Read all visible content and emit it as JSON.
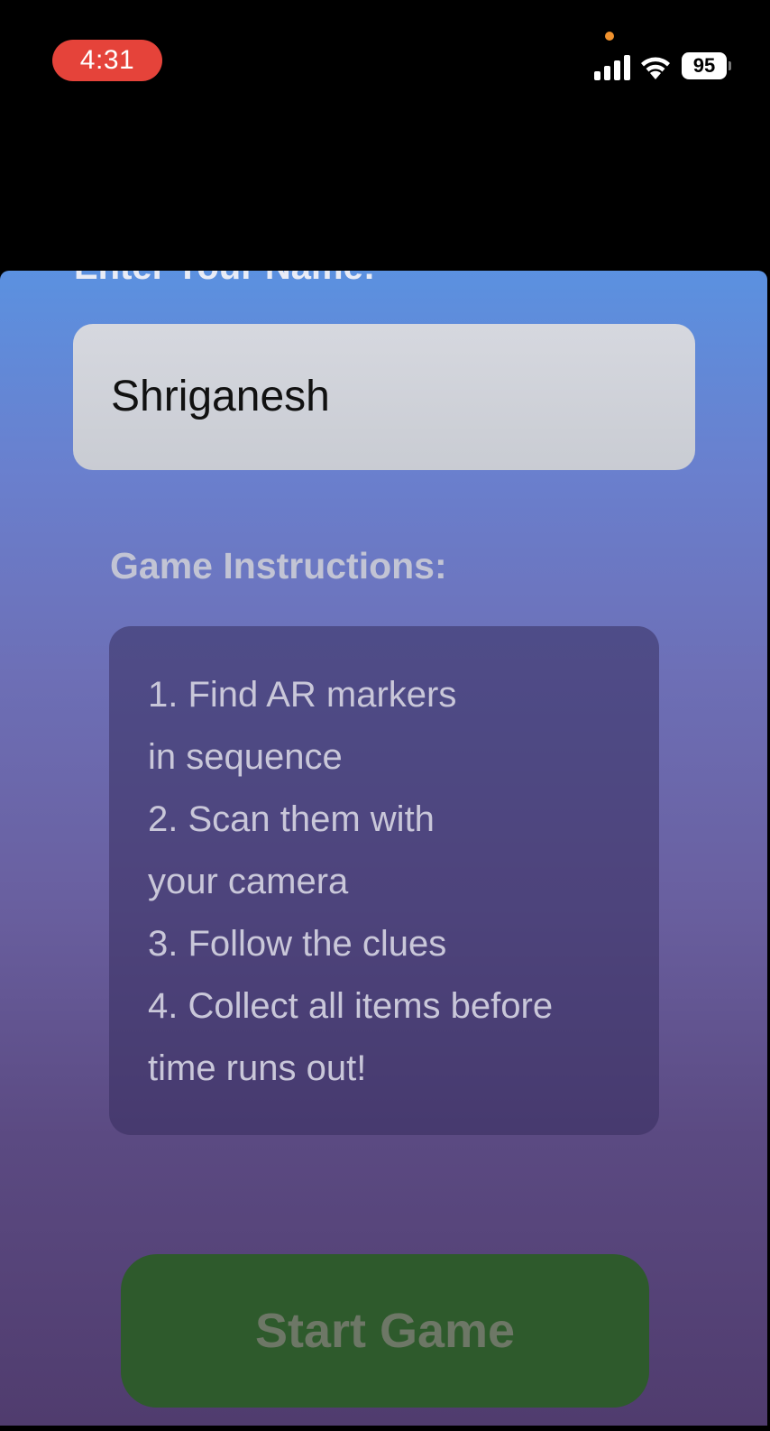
{
  "status_bar": {
    "time": "4:31",
    "battery_level": "95",
    "icons": [
      "privacy-dot",
      "cellular-signal-icon",
      "wifi-icon",
      "battery-icon"
    ],
    "colors": {
      "time_pill": "#e5433a",
      "privacy_dot": "#f0922e"
    }
  },
  "form": {
    "name_label": "Enter Your Name:",
    "name_value": "Shriganesh"
  },
  "instructions": {
    "heading": "Game Instructions:",
    "lines": [
      "1. Find AR markers",
      "in sequence",
      "2. Scan them with",
      "your camera",
      "3. Follow the clues",
      "4. Collect all items before",
      "time runs out!"
    ]
  },
  "actions": {
    "start_label": "Start Game",
    "start_color": "#2e5a2c"
  }
}
